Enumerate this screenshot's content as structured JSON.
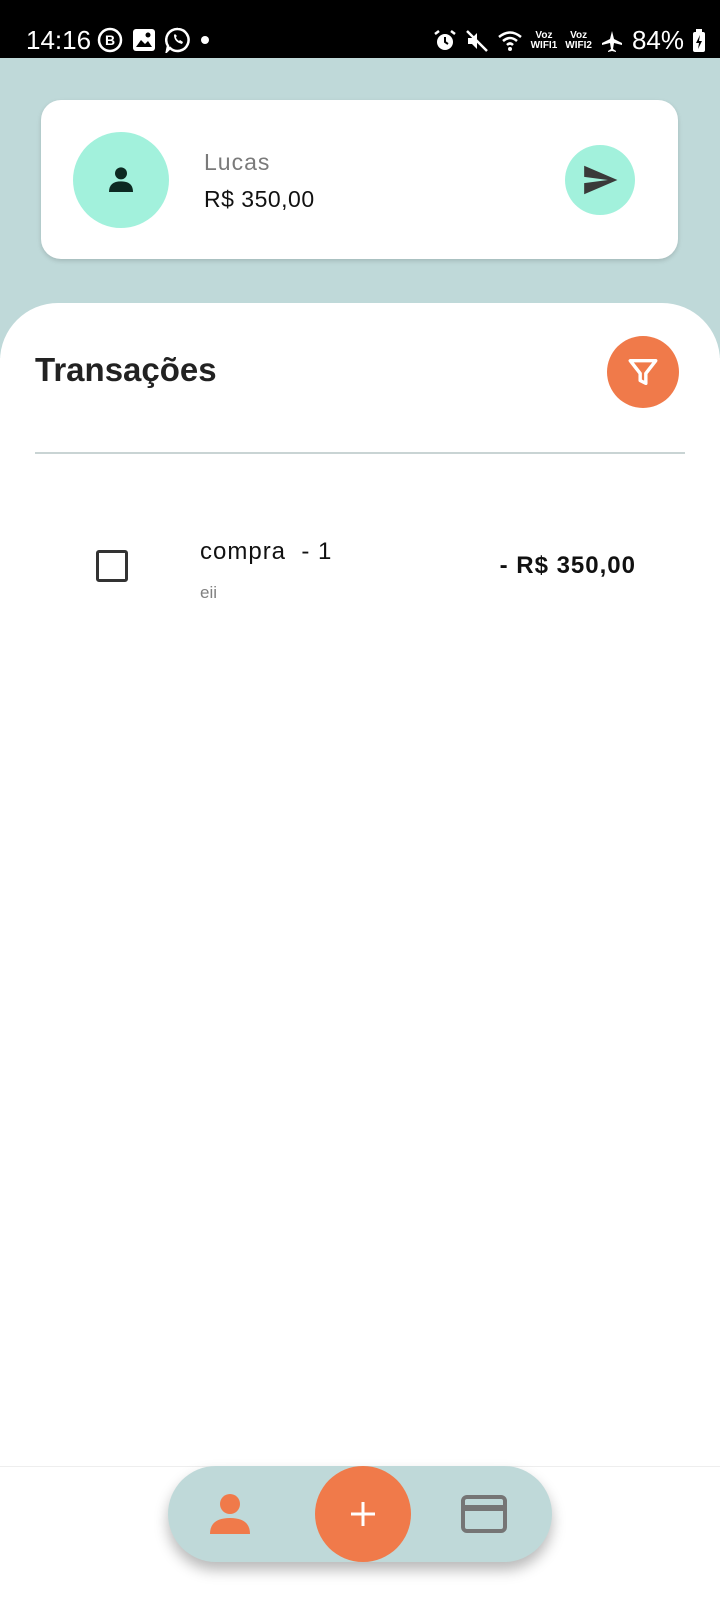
{
  "status_bar": {
    "time": "14:16",
    "battery": "84%",
    "voz1": "Voz",
    "wifi1": "WIFI1",
    "voz2": "Voz",
    "wifi2": "WIFI2",
    "left_icons": [
      "b-badge-icon",
      "gallery-icon",
      "whatsapp-icon",
      "dot-icon"
    ],
    "right_icons": [
      "alarm-icon",
      "mute-icon",
      "wifi-icon",
      "airplane-icon",
      "battery-icon"
    ]
  },
  "account": {
    "name": "Lucas",
    "balance": "R$ 350,00",
    "avatar_icon": "person-icon",
    "send_icon": "send-icon"
  },
  "transactions": {
    "title": "Transações",
    "filter_icon": "filter-icon",
    "items": [
      {
        "title": "compra  - 1",
        "description": "eii",
        "amount": "- R$ 350,00",
        "checked": false
      }
    ]
  },
  "bottom_nav": {
    "items": [
      "person-icon",
      "add-icon",
      "credit-card-icon"
    ]
  },
  "colors": {
    "teal_bg": "#bfd9d9",
    "mint": "#a2f1dc",
    "orange": "#f07a4a"
  }
}
